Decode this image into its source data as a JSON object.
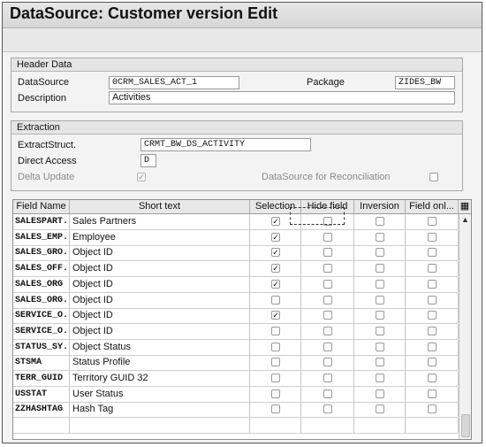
{
  "window": {
    "title": "DataSource: Customer version Edit"
  },
  "header_data": {
    "group_title": "Header Data",
    "datasource_label": "DataSource",
    "datasource_value": "0CRM_SALES_ACT_1",
    "package_label": "Package",
    "package_value": "ZIDES_BW",
    "description_label": "Description",
    "description_value": "Activities"
  },
  "extraction": {
    "group_title": "Extraction",
    "extract_struct_label": "ExtractStruct.",
    "extract_struct_value": "CRMT_BW_DS_ACTIVITY",
    "direct_access_label": "Direct Access",
    "direct_access_value": "D",
    "delta_update_label": "Delta Update",
    "delta_update_checked": true,
    "reconciliation_label": "DataSource for Reconciliation",
    "reconciliation_checked": false
  },
  "table": {
    "columns": [
      "Field Name",
      "Short text",
      "Selection",
      "Hide field",
      "Inversion",
      "Field onl..."
    ],
    "rows": [
      {
        "field": "SALESPART...",
        "text": "Sales Partners",
        "selection": true
      },
      {
        "field": "SALES_EMP...",
        "text": "Employee",
        "selection": true
      },
      {
        "field": "SALES_GRO...",
        "text": "Object ID",
        "selection": true
      },
      {
        "field": "SALES_OFF...",
        "text": "Object ID",
        "selection": true
      },
      {
        "field": "SALES_ORG",
        "text": "Object ID",
        "selection": true
      },
      {
        "field": "SALES_ORG...",
        "text": "Object ID",
        "selection": false
      },
      {
        "field": "SERVICE_O...",
        "text": "Object ID",
        "selection": true
      },
      {
        "field": "SERVICE_O...",
        "text": "Object ID",
        "selection": false
      },
      {
        "field": "STATUS_SY...",
        "text": "Object Status",
        "selection": false
      },
      {
        "field": "STSMA",
        "text": "Status Profile",
        "selection": false
      },
      {
        "field": "TERR_GUID",
        "text": "Territory GUID 32",
        "selection": false
      },
      {
        "field": "USSTAT",
        "text": "User Status",
        "selection": false
      },
      {
        "field": "ZZHASHTAG",
        "text": "Hash Tag",
        "selection": false
      }
    ],
    "column_config_icon": "table-settings-icon"
  }
}
